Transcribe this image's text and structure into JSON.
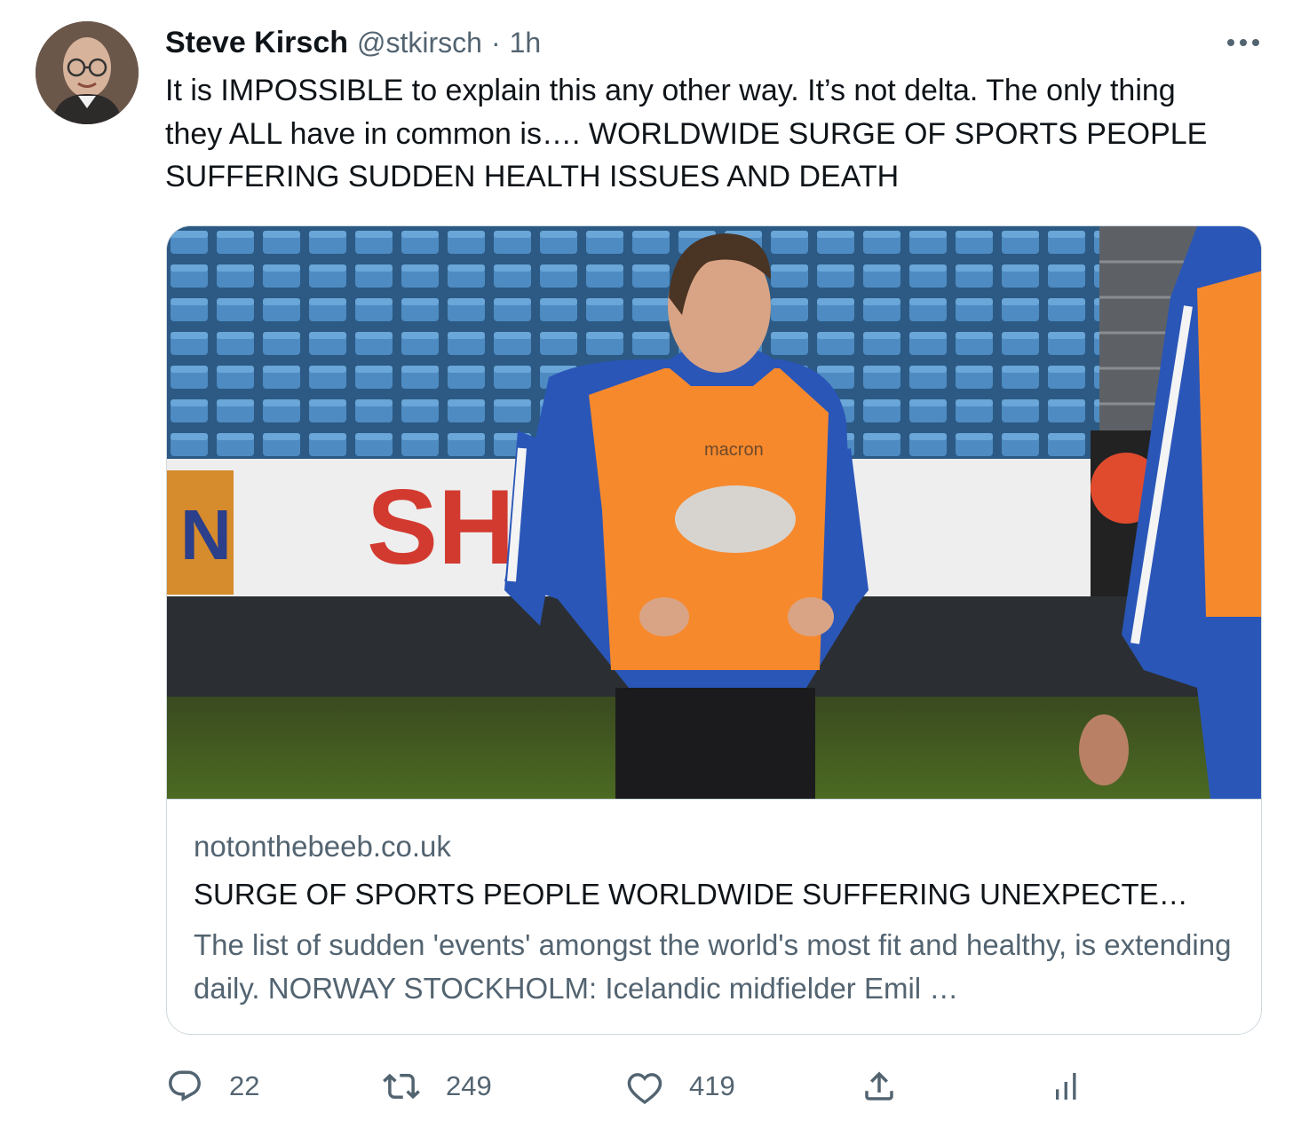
{
  "tweet": {
    "author_name": "Steve Kirsch",
    "handle": "@stkirsch",
    "separator": "·",
    "time": "1h",
    "text": "It is IMPOSSIBLE to explain this any other way.  It’s not delta. The only thing they ALL have in common is…. WORLDWIDE SURGE OF SPORTS PEOPLE SUFFERING SUDDEN HEALTH ISSUES AND DEATH"
  },
  "card": {
    "image_sign_text": "SH",
    "image_side_letter": "N",
    "bib_brand": "macron",
    "domain": "notonthebeeb.co.uk",
    "title": "SURGE OF SPORTS PEOPLE WORLDWIDE SUFFERING UNEXPECTE…",
    "description": "The list of sudden 'events' amongst the world's most fit and healthy, is extending daily. NORWAY STOCKHOLM: Icelandic midfielder Emil …"
  },
  "actions": {
    "reply_count": "22",
    "retweet_count": "249",
    "like_count": "419"
  },
  "colors": {
    "text_primary": "#0f1419",
    "text_secondary": "#536471",
    "border": "#cfd9de"
  },
  "icons": [
    "more-icon",
    "reply-icon",
    "retweet-icon",
    "like-icon",
    "share-icon",
    "analytics-icon"
  ]
}
